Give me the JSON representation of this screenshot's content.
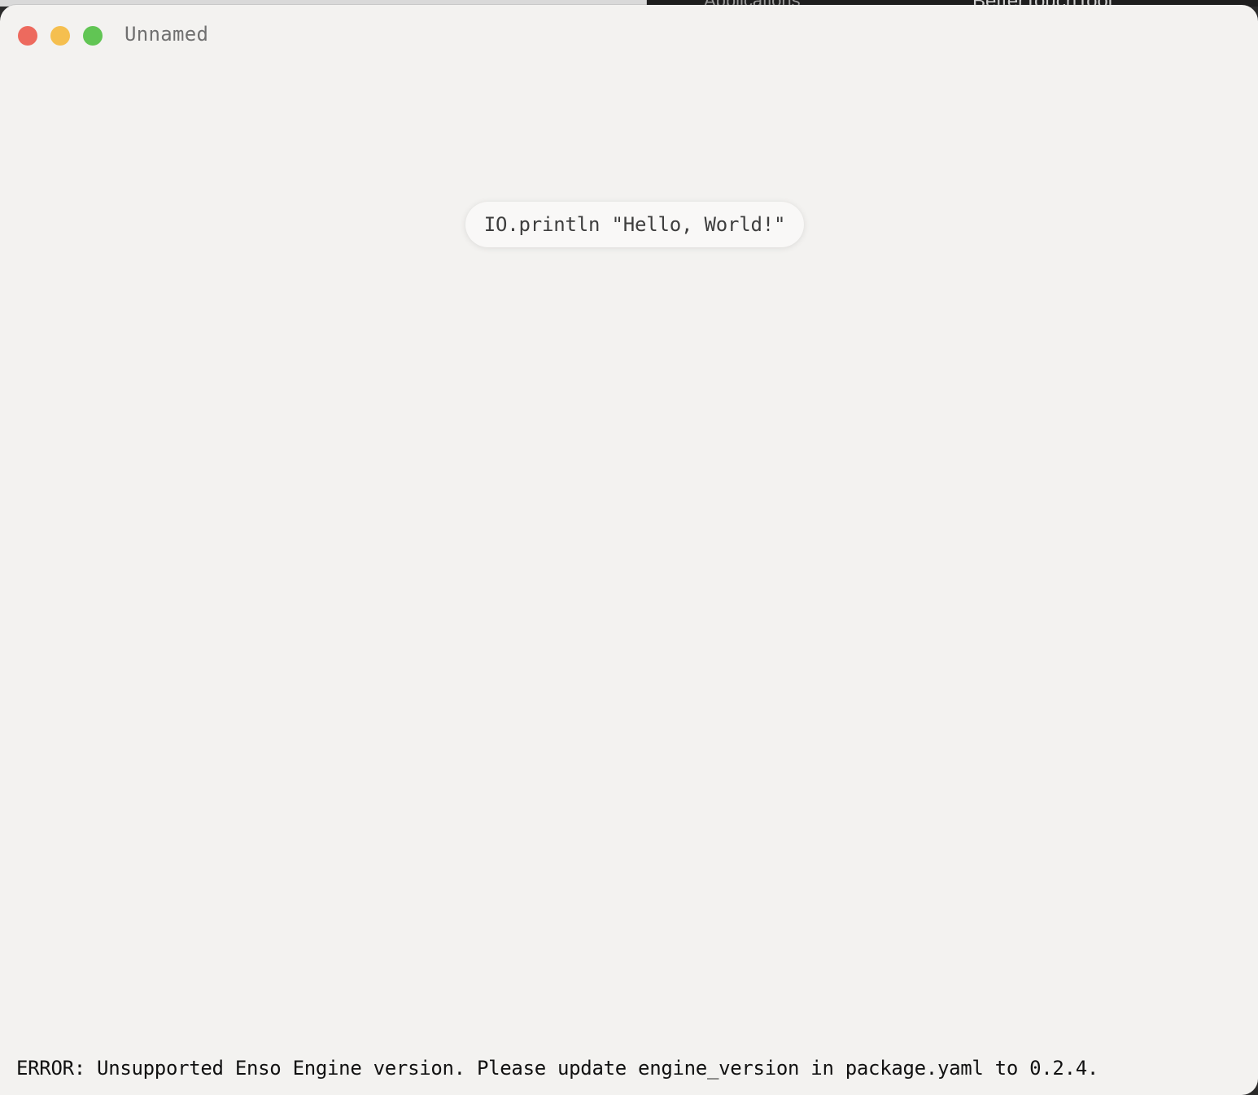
{
  "background": {
    "strip_text_1": "Applications",
    "strip_text_2": "BetterTouchTool"
  },
  "window": {
    "title": "Unnamed",
    "controls": {
      "close": "#ed6a5e",
      "minimize": "#f5bf4f",
      "maximize": "#61c554"
    }
  },
  "graph": {
    "nodes": [
      {
        "code": "IO.println \"Hello, World!\""
      }
    ]
  },
  "status": {
    "message": "ERROR: Unsupported Enso Engine version. Please update engine_version in package.yaml to 0.2.4."
  }
}
